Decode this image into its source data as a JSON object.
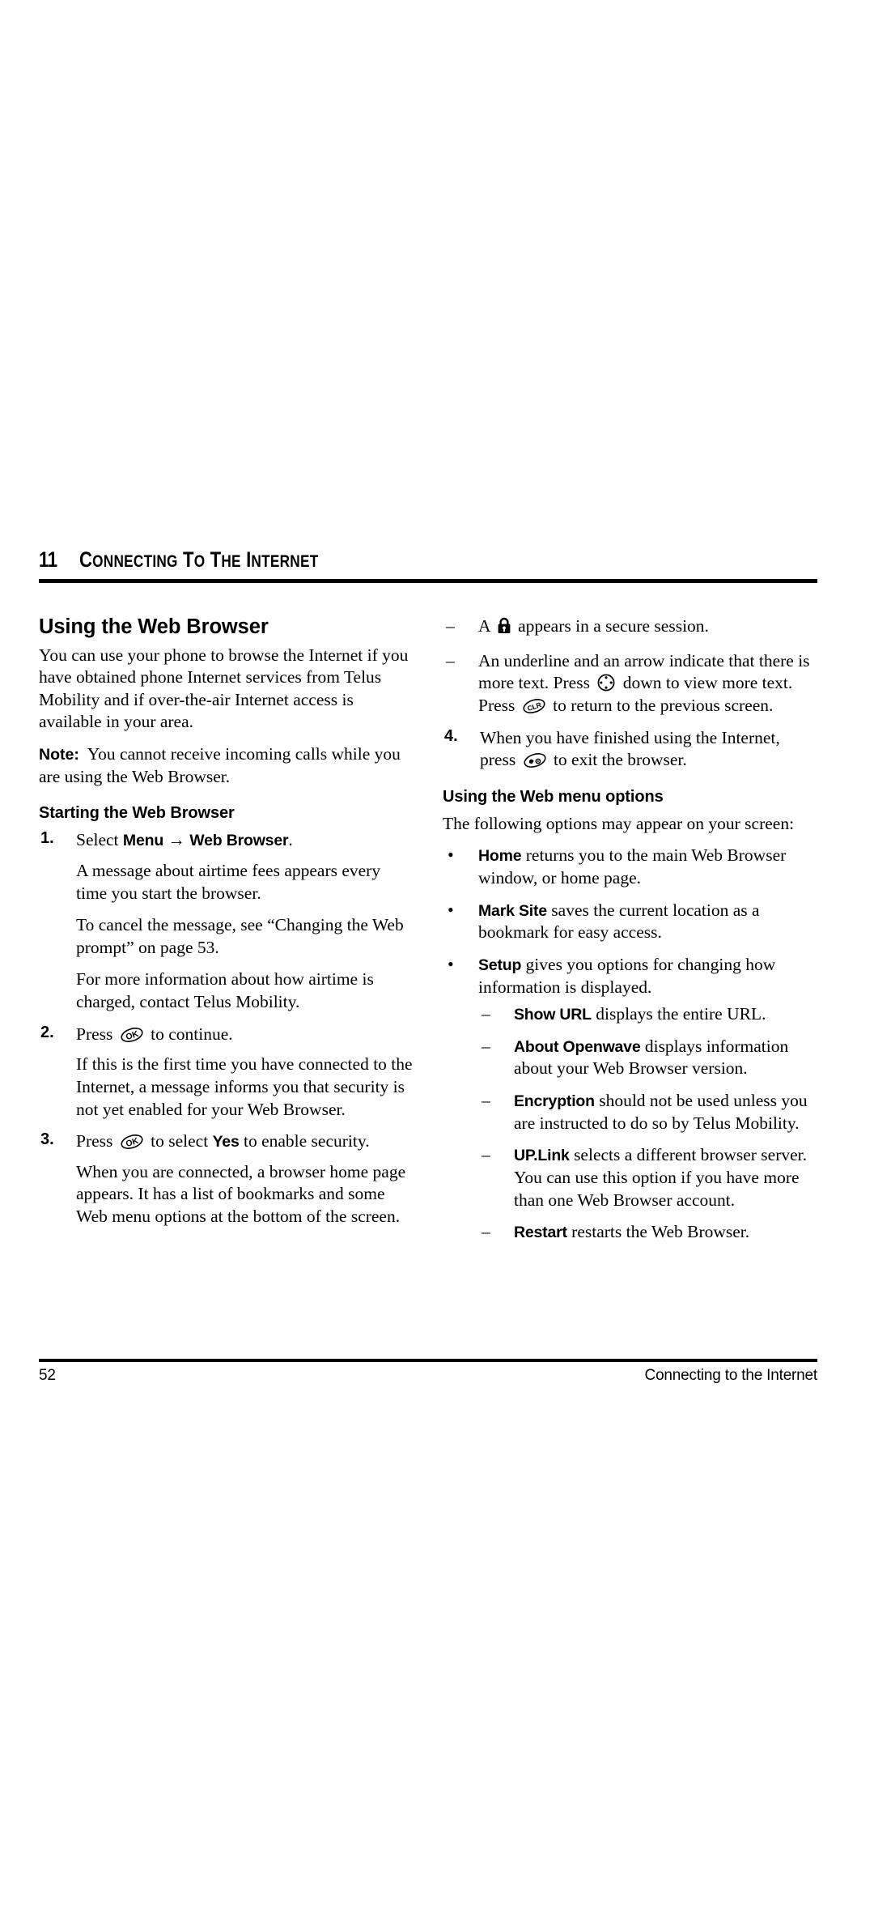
{
  "chapter": {
    "number": "11",
    "title_first_letter": "C",
    "title": "ONNECTING",
    "title_word2_first": "T",
    "title_word2": "O",
    "title_word3_first": "T",
    "title_word3": "HE",
    "title_word4_first": "I",
    "title_word4": "NTERNET",
    "full_title": "11 CONNECTING TO THE INTERNET"
  },
  "left": {
    "section_heading": "Using the Web Browser",
    "intro": "You can use your phone to browse the Internet if you have obtained phone Internet services from Telus Mobility and if over-the-air Internet access is available in your area.",
    "note_label": "Note:",
    "note_text": "You cannot receive incoming calls while you are using the Web Browser.",
    "sub_heading": "Starting the Web Browser",
    "steps": [
      {
        "num": "1.",
        "lead_pre": "Select ",
        "ui1": "Menu",
        "arrow": " → ",
        "ui2": "Web Browser",
        "lead_post": ".",
        "paras": [
          "A message about airtime fees appears every time you start the browser.",
          "To cancel the message, see “Changing the Web prompt” on page 53.",
          "For more information about how airtime is charged, contact Telus Mobility."
        ]
      },
      {
        "num": "2.",
        "lead_pre": "Press ",
        "icon": "ok-key-icon",
        "lead_post": " to continue.",
        "paras": [
          "If this is the first time you have connected to the Internet, a message informs you that security is not yet enabled for your Web Browser."
        ]
      },
      {
        "num": "3.",
        "lead_pre": "Press ",
        "icon": "ok-key-icon",
        "lead_mid": " to select ",
        "ui1": "Yes",
        "lead_post": " to enable security.",
        "paras": [
          "When you are connected, a browser home page appears. It has a list of bookmarks and some Web menu options at the bottom of the screen."
        ]
      }
    ]
  },
  "right": {
    "dashes_top": [
      {
        "pre": "A ",
        "icon": "padlock-icon",
        "post": " appears in a secure session."
      },
      {
        "pre": "An underline and an arrow indicate that there is more text. Press ",
        "icon": "navigation-key-icon",
        "mid": " down to view more text. Press ",
        "icon2": "clr-key-icon",
        "post": " to return to the previous screen."
      }
    ],
    "step4": {
      "num": "4.",
      "pre": "When you have finished using the Internet, press ",
      "icon": "end-key-icon",
      "post": " to exit the browser."
    },
    "sub_heading": "Using the Web menu options",
    "lead_in": "The following options may appear on your screen:",
    "bullets": [
      {
        "term": "Home",
        "text": " returns you to the main Web Browser window, or home page."
      },
      {
        "term": "Mark Site",
        "text": " saves the current location as a bookmark for easy access."
      },
      {
        "term": "Setup",
        "text": " gives you options for changing how information is displayed."
      }
    ],
    "setup_dashes": [
      {
        "term": "Show URL",
        "text": " displays the entire URL."
      },
      {
        "term": "About Openwave",
        "text": " displays information about your Web Browser version."
      },
      {
        "term": "Encryption",
        "text": " should not be used unless you are instructed to do so by Telus Mobility."
      },
      {
        "term": "UP.Link",
        "text": " selects a different browser server. You can use this option if you have more than one Web Browser account."
      },
      {
        "term": "Restart",
        "text": " restarts the Web Browser."
      }
    ]
  },
  "footer": {
    "page_number": "52",
    "running_title": "Connecting to the Internet"
  },
  "bullet_glyph": "•",
  "dash_glyph": "–"
}
